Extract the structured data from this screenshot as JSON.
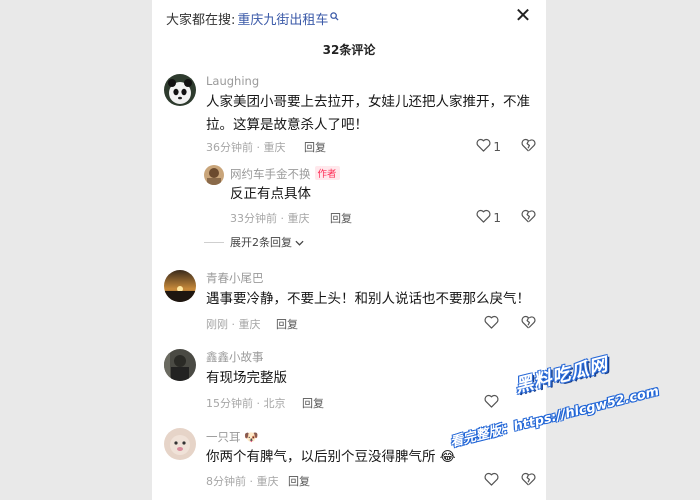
{
  "search": {
    "prefix": "大家都在搜:",
    "term": "重庆九街出租车"
  },
  "header": {
    "count": "32条评论",
    "close": "✕"
  },
  "comments": [
    {
      "user": "Laughing",
      "text1": "人家美团小哥要上去拉开，女娃儿还把人家推开，不准",
      "text2": "拉。这算是故意杀人了吧！",
      "meta": "36分钟前 · 重庆",
      "reply": "回复",
      "likes": "1"
    },
    {
      "user": "网约车手金不换",
      "tag": "作者",
      "text1": "反正有点具体",
      "meta": "33分钟前 · 重庆",
      "reply": "回复",
      "likes": "1"
    },
    {
      "user": "青春小尾巴",
      "text1": "遇事要冷静，不要上头！和别人说话也不要那么戾气！",
      "meta": "刚刚 · 重庆",
      "reply": "回复",
      "likes": ""
    },
    {
      "user": "鑫鑫小故事",
      "text1": "有现场完整版",
      "meta": "15分钟前 · 北京",
      "reply": "回复",
      "likes": ""
    },
    {
      "user": "一只耳",
      "text1": "你两个有脾气，以后别个豆没得脾气所",
      "meta": "8分钟前 · 重庆",
      "reply": "回复",
      "likes": ""
    }
  ],
  "expand_label": "展开2条回复",
  "watermark": {
    "line1": "黑料吃瓜网",
    "line2": "看完整版：https://hlcgw52.com"
  },
  "colors": {
    "accent": "#3b5aa8",
    "author_tag": "#fe2c55",
    "watermark": "#2b6bd8"
  }
}
